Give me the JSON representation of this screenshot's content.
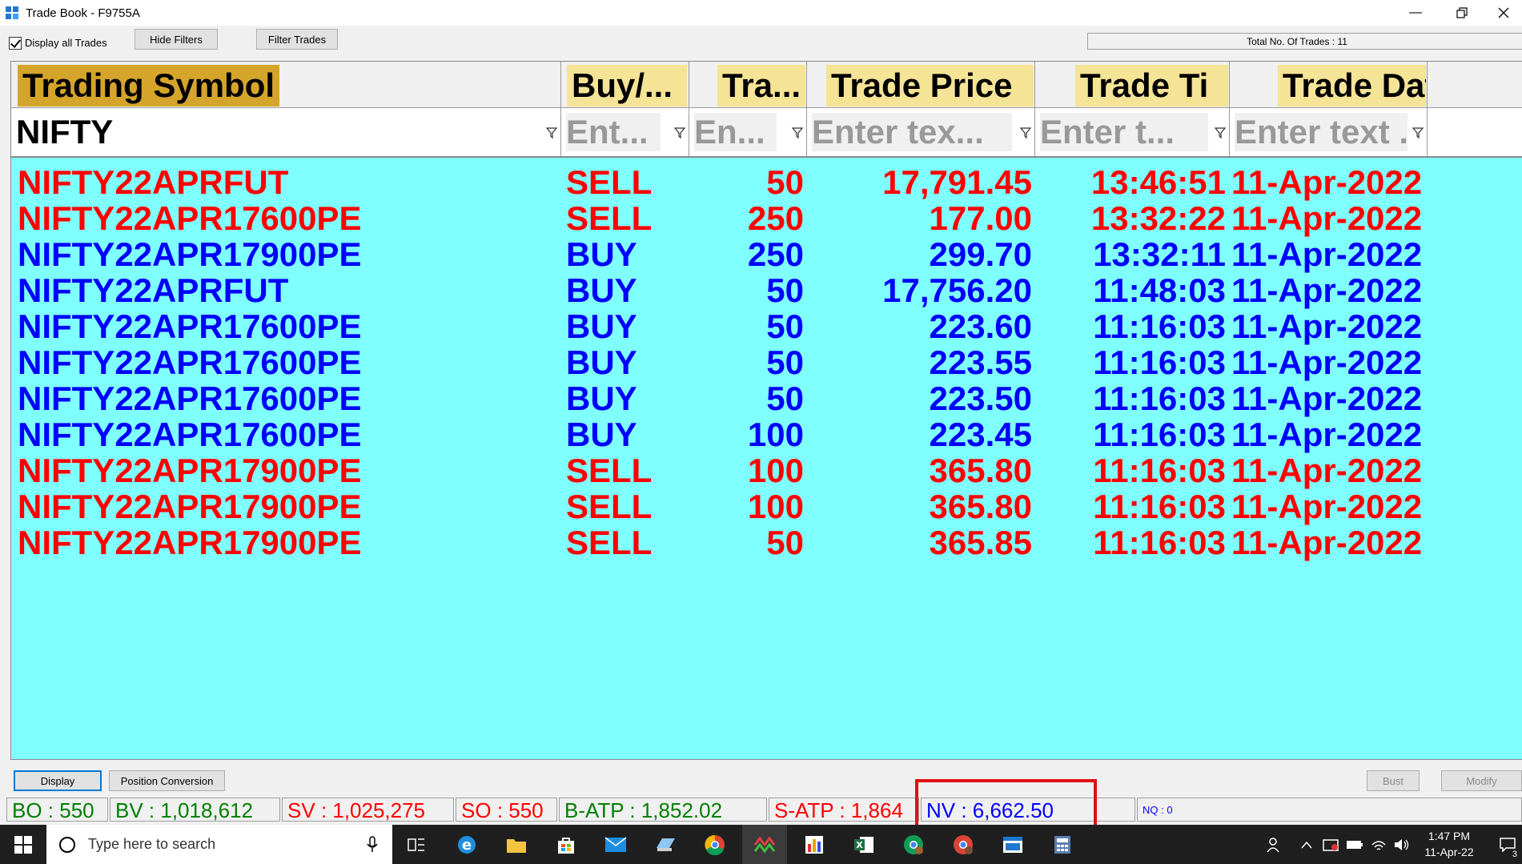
{
  "window": {
    "title": "Trade Book - F9755A"
  },
  "toolbar": {
    "display_all_label": "Display all Trades",
    "hide_filters_label": "Hide Filters",
    "filter_trades_label": "Filter Trades",
    "total_trades": "Total No. Of Trades : 11"
  },
  "columns": [
    {
      "label": "Trading Symbol",
      "filter": "NIFTY"
    },
    {
      "label": "Buy/...",
      "filter": "Ent..."
    },
    {
      "label": "Tra...",
      "filter": "En..."
    },
    {
      "label": "Trade Price",
      "filter": "Enter tex..."
    },
    {
      "label": "Trade Ti",
      "filter": "Enter t..."
    },
    {
      "label": "Trade Date",
      "filter": "Enter text ..."
    }
  ],
  "trades": [
    {
      "symbol": "NIFTY22APRFUT",
      "side": "SELL",
      "qty": "50",
      "price": "17,791.45",
      "time": "13:46:51",
      "date": "11-Apr-2022"
    },
    {
      "symbol": "NIFTY22APR17600PE",
      "side": "SELL",
      "qty": "250",
      "price": "177.00",
      "time": "13:32:22",
      "date": "11-Apr-2022"
    },
    {
      "symbol": "NIFTY22APR17900PE",
      "side": "BUY",
      "qty": "250",
      "price": "299.70",
      "time": "13:32:11",
      "date": "11-Apr-2022"
    },
    {
      "symbol": "NIFTY22APRFUT",
      "side": "BUY",
      "qty": "50",
      "price": "17,756.20",
      "time": "11:48:03",
      "date": "11-Apr-2022"
    },
    {
      "symbol": "NIFTY22APR17600PE",
      "side": "BUY",
      "qty": "50",
      "price": "223.60",
      "time": "11:16:03",
      "date": "11-Apr-2022"
    },
    {
      "symbol": "NIFTY22APR17600PE",
      "side": "BUY",
      "qty": "50",
      "price": "223.55",
      "time": "11:16:03",
      "date": "11-Apr-2022"
    },
    {
      "symbol": "NIFTY22APR17600PE",
      "side": "BUY",
      "qty": "50",
      "price": "223.50",
      "time": "11:16:03",
      "date": "11-Apr-2022"
    },
    {
      "symbol": "NIFTY22APR17600PE",
      "side": "BUY",
      "qty": "100",
      "price": "223.45",
      "time": "11:16:03",
      "date": "11-Apr-2022"
    },
    {
      "symbol": "NIFTY22APR17900PE",
      "side": "SELL",
      "qty": "100",
      "price": "365.80",
      "time": "11:16:03",
      "date": "11-Apr-2022"
    },
    {
      "symbol": "NIFTY22APR17900PE",
      "side": "SELL",
      "qty": "100",
      "price": "365.80",
      "time": "11:16:03",
      "date": "11-Apr-2022"
    },
    {
      "symbol": "NIFTY22APR17900PE",
      "side": "SELL",
      "qty": "50",
      "price": "365.85",
      "time": "11:16:03",
      "date": "11-Apr-2022"
    }
  ],
  "bottom": {
    "display_label": "Display",
    "position_conversion_label": "Position Conversion",
    "bust_label": "Bust",
    "modify_label": "Modify"
  },
  "status": {
    "bo": "BO : 550",
    "bv": "BV : 1,018,612",
    "sv": "SV : 1,025,275",
    "so": "SO : 550",
    "batp": "B-ATP : 1,852.02",
    "satp": "S-ATP : 1,864",
    "nv": "NV : 6,662.50",
    "nq": "NQ : 0"
  },
  "taskbar": {
    "search_placeholder": "Type here to search",
    "time": "1:47 PM",
    "date": "11-Apr-22",
    "notifications": "3"
  },
  "colors": {
    "grid_bg": "#80ffff",
    "sell": "#ff0000",
    "buy": "#0000ff",
    "highlight": "#e01010"
  }
}
